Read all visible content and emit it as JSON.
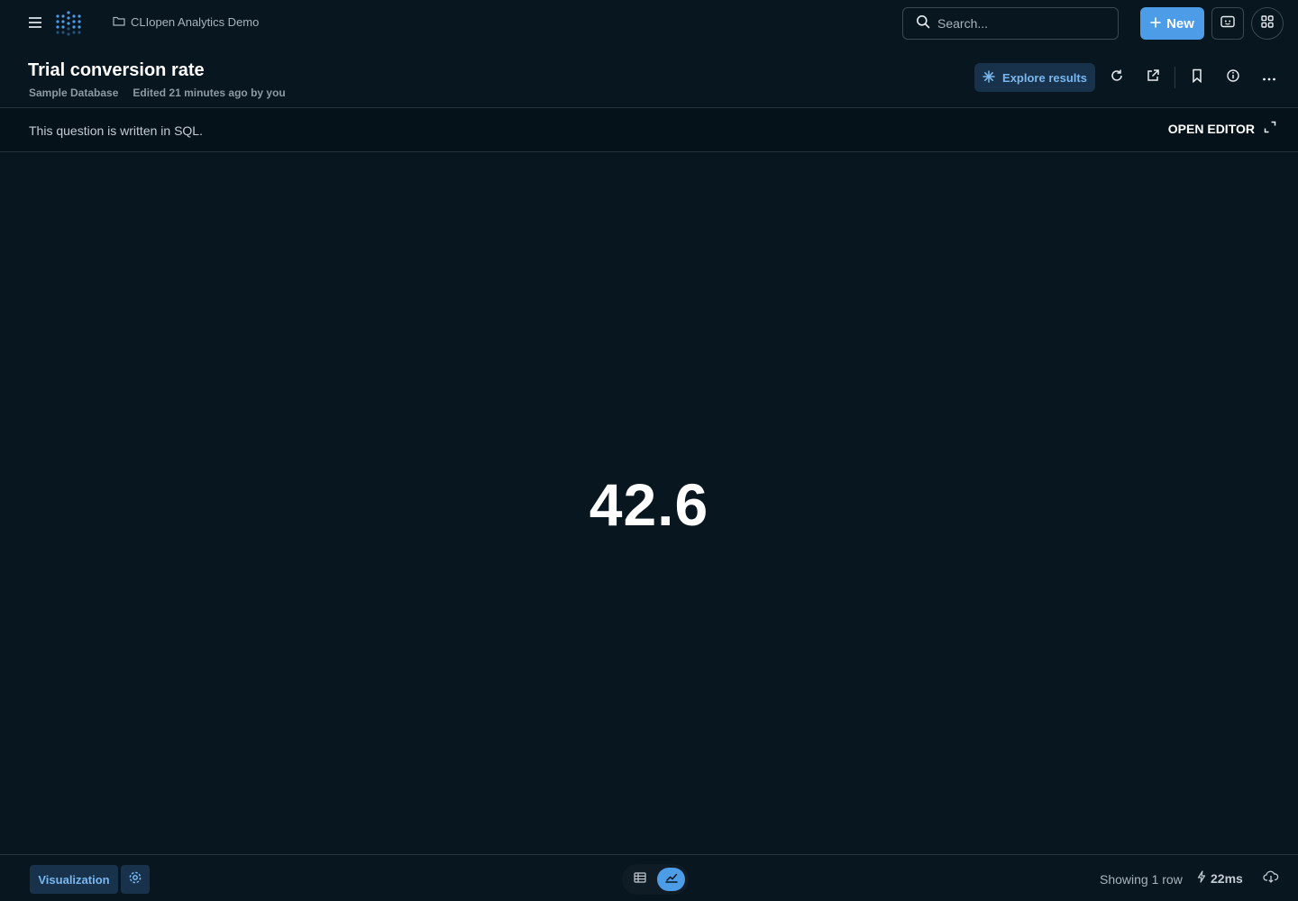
{
  "topbar": {
    "breadcrumb_collection": "CLIopen Analytics Demo",
    "search_placeholder": "Search...",
    "new_label": "New"
  },
  "question": {
    "title": "Trial conversion rate",
    "database": "Sample Database",
    "edited": "Edited 21 minutes ago by you",
    "explore_label": "Explore results"
  },
  "sqlbar": {
    "text": "This question is written in SQL.",
    "open_editor_label": "OPEN EDITOR"
  },
  "scalar": {
    "value": "42.6"
  },
  "footer": {
    "visualization_label": "Visualization",
    "row_count": "Showing 1 row",
    "timing": "22ms",
    "view_mode": "chart"
  },
  "colors": {
    "background": "#08161f",
    "accent": "#4d9ce8",
    "accent_muted_bg": "#17324a",
    "text_primary": "#ffffff",
    "text_secondary": "#a7b3bd"
  }
}
